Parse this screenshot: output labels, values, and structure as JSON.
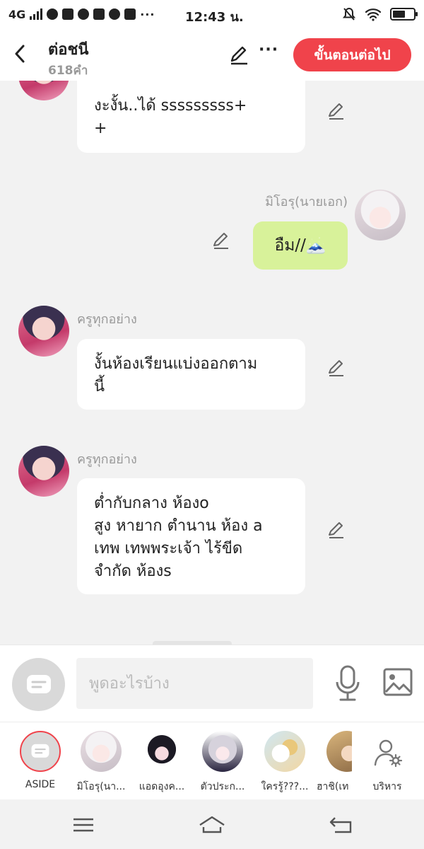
{
  "status_bar": {
    "network": "4G",
    "time": "12:43 น.",
    "overflow": "···",
    "battery_level": 0.6
  },
  "header": {
    "title": "ต่อชนี",
    "word_count": "618คำ",
    "more": "···",
    "next_button": "ขั้นตอนต่อไป"
  },
  "messages": [
    {
      "sender": "",
      "text": "งะงั้น..ได้ sssssssss+\n+",
      "mine": false,
      "avatar": "boy-avatar"
    },
    {
      "sender": "มิโอรุ(นายเอก)",
      "text": "อืม//🗻",
      "mine": true,
      "avatar": "white-hair-avatar"
    },
    {
      "sender": "ครูทุกอย่าง",
      "text": "งั้นห้องเรียนแบ่งออกตาม\nนี้",
      "mine": false,
      "avatar": "boy-avatar"
    },
    {
      "sender": "ครูทุกอย่าง",
      "text": "ต่ำกับกลาง ห้องo\nสูง หายาก ตำนาน ห้อง a\nเทพ เทพพระเจ้า ไร้ขีด\nจำกัด ห้องs",
      "mine": false,
      "avatar": "boy-avatar"
    }
  ],
  "input": {
    "placeholder": "พูดอะไรบ้าง"
  },
  "characters": [
    {
      "name": "ASIDE"
    },
    {
      "name": "มิโอรุ(นา..."
    },
    {
      "name": "แอดอุงค..."
    },
    {
      "name": "ตัวประก..."
    },
    {
      "name": "ใครรู้???..."
    },
    {
      "name": "ฮาชิ(เท"
    },
    {
      "name": "บริหาร"
    }
  ],
  "colors": {
    "accent": "#f0434b",
    "my_bubble": "#d8f29a",
    "background": "#f2f2f2"
  }
}
